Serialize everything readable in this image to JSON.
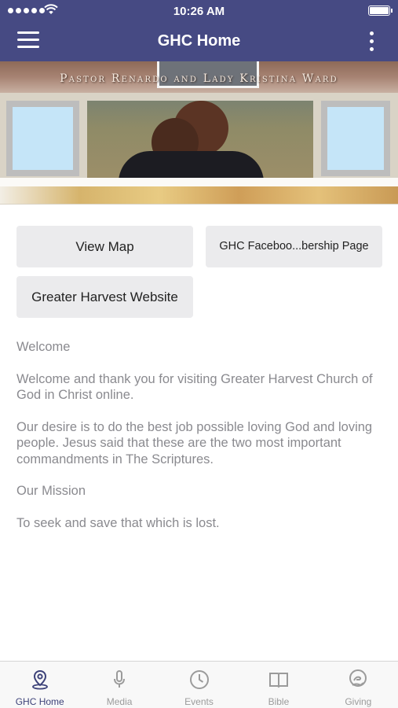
{
  "status_bar": {
    "time": "10:26 AM",
    "icons": [
      "signal-dots-icon",
      "wifi-icon",
      "battery-icon"
    ]
  },
  "nav_bar": {
    "title": "GHC Home",
    "left_icon": "menu-icon",
    "right_icon": "more-vertical-icon",
    "background_color": "#464a83"
  },
  "banner": {
    "caption": "Pastor Renardo and Lady Kristina Ward"
  },
  "buttons": {
    "view_map": "View Map",
    "facebook": "GHC Faceboo...bership Page",
    "website": "Greater Harvest Website"
  },
  "content": {
    "welcome_heading": "Welcome",
    "welcome_text": "Welcome and thank you for visiting Greater Harvest Church of God in Christ online.",
    "desire_text": "Our desire is to do the best job possible loving God and loving people. Jesus said that these are the two most important commandments in The Scriptures.",
    "mission_heading": "Our Mission",
    "mission_text": "To seek and save that which is lost."
  },
  "tab_bar": {
    "active_color": "#3d4279",
    "tabs": [
      {
        "label": "GHC Home",
        "icon": "location-pin-icon",
        "active": true
      },
      {
        "label": "Media",
        "icon": "microphone-icon",
        "active": false
      },
      {
        "label": "Events",
        "icon": "clock-icon",
        "active": false
      },
      {
        "label": "Bible",
        "icon": "book-icon",
        "active": false
      },
      {
        "label": "Giving",
        "icon": "giving-hand-icon",
        "active": false
      }
    ]
  }
}
